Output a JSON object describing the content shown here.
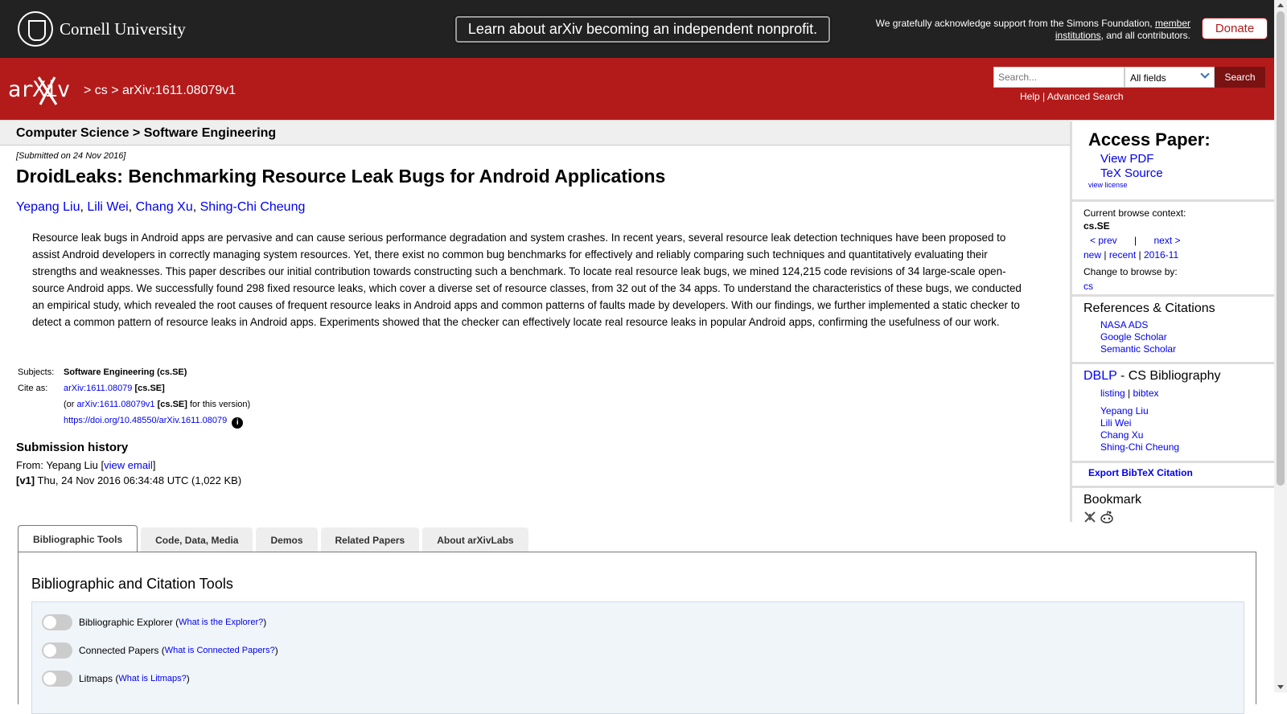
{
  "topbar": {
    "brand": "Cornell University",
    "nonprofit_banner": "Learn about arXiv becoming an independent nonprofit.",
    "support_prefix": "We gratefully acknowledge support from the Simons Foundation,",
    "support_link": "member institutions",
    "support_suffix": ", and all contributors.",
    "donate": "Donate"
  },
  "header": {
    "logo_text": "arXiv",
    "breadcrumb": "> cs > arXiv:1611.08079v1",
    "search_placeholder": "Search...",
    "search_field_selected": "All fields",
    "search_button": "Search",
    "help": "Help",
    "separator": "|",
    "advanced": "Advanced Search"
  },
  "paper": {
    "subject_heading": "Computer Science > Software Engineering",
    "submitted": "[Submitted on 24 Nov 2016]",
    "title": "DroidLeaks: Benchmarking Resource Leak Bugs for Android Applications",
    "authors": [
      "Yepang Liu",
      "Lili Wei",
      "Chang Xu",
      "Shing-Chi Cheung"
    ],
    "abstract": "Resource leak bugs in Android apps are pervasive and can cause serious performance degradation and system crashes. In recent years, several resource leak detection techniques have been proposed to assist Android developers in correctly managing system resources. Yet, there exist no common bug benchmarks for effectively and reliably comparing such techniques and quantitatively evaluating their strengths and weaknesses. This paper describes our initial contribution towards constructing such a benchmark. To locate real resource leak bugs, we mined 124,215 code revisions of 34 large-scale open-source Android apps. We successfully found 298 fixed resource leaks, which cover a diverse set of resource classes, from 32 out of the 34 apps. To understand the characteristics of these bugs, we conducted an empirical study, which revealed the root causes of frequent resource leaks in Android apps and common patterns of faults made by developers. With our findings, we further implemented a static checker to detect a common pattern of resource leaks in Android apps. Experiments showed that the checker can effectively locate real resource leaks in popular Android apps, confirming the usefulness of our work.",
    "subjects_label": "Subjects:",
    "subjects_value": "Software Engineering (cs.SE)",
    "cite_label": "Cite as:",
    "cite_id": "arXiv:1611.08079",
    "cite_tag": "[cs.SE]",
    "cite_version_prefix": "(or",
    "cite_version_id": "arXiv:1611.08079v1",
    "cite_version_tag": "[cs.SE]",
    "cite_version_suffix": "for this version)",
    "doi": "https://doi.org/10.48550/arXiv.1611.08079",
    "history_heading": "Submission history",
    "from_prefix": "From: Yepang Liu [",
    "view_email": "view email",
    "from_suffix": "]",
    "v1_label": "[v1]",
    "v1_text": "Thu, 24 Nov 2016 06:34:48 UTC (1,022 KB)"
  },
  "sidebar": {
    "access_title": "Access Paper:",
    "view_pdf": "View PDF",
    "tex_source": "TeX Source",
    "view_license": "view license",
    "browse_context_label": "Current browse context:",
    "browse_context": "cs.SE",
    "prev": "< prev",
    "pipe": "|",
    "next": "next >",
    "new": "new",
    "recent": "recent",
    "month": "2016-11",
    "change_browse": "Change to browse by:",
    "cs": "cs",
    "refs_title": "References & Citations",
    "refs": [
      "NASA ADS",
      "Google Scholar",
      "Semantic Scholar"
    ],
    "dblp": "DBLP",
    "dblp_suffix": " - CS Bibliography",
    "listing": "listing",
    "bibtex": "bibtex",
    "dblp_authors": [
      "Yepang Liu",
      "Lili Wei",
      "Chang Xu",
      "Shing-Chi Cheung"
    ],
    "export": "Export BibTeX Citation",
    "bookmark": "Bookmark"
  },
  "tabs": {
    "items": [
      "Bibliographic Tools",
      "Code, Data, Media",
      "Demos",
      "Related Papers",
      "About arXivLabs"
    ],
    "active_index": 0
  },
  "tools": {
    "title": "Bibliographic and Citation Tools",
    "rows": [
      {
        "label": "Bibliographic Explorer",
        "help": "What is the Explorer?"
      },
      {
        "label": "Connected Papers",
        "help": "What is Connected Papers?"
      },
      {
        "label": "Litmaps",
        "help": "What is Litmaps?"
      }
    ]
  }
}
